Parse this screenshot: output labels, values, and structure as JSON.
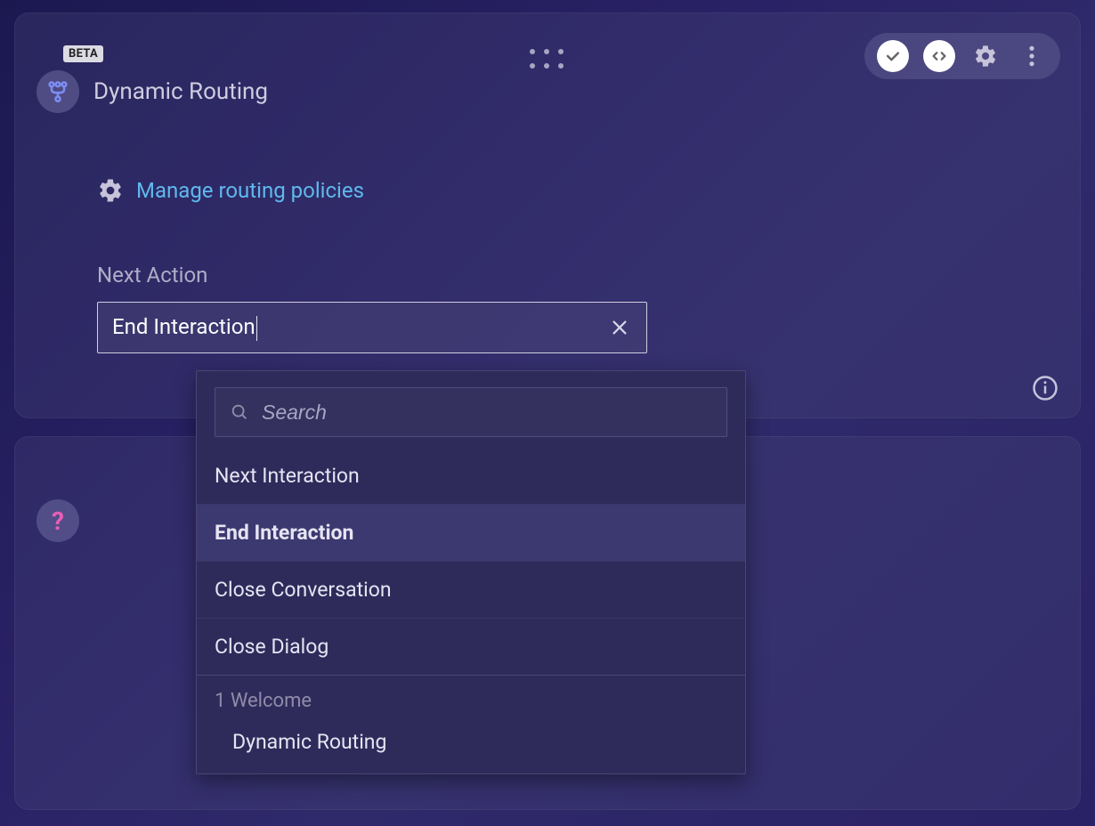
{
  "card": {
    "badge": "BETA",
    "title": "Dynamic Routing",
    "manage_link": "Manage routing policies",
    "field_label": "Next Action",
    "field_value": "End Interaction"
  },
  "dropdown": {
    "search_placeholder": "Search",
    "options": [
      {
        "label": "Next Interaction",
        "selected": false
      },
      {
        "label": "End Interaction",
        "selected": true
      },
      {
        "label": "Close Conversation",
        "selected": false
      },
      {
        "label": "Close Dialog",
        "selected": false
      }
    ],
    "groups": [
      {
        "label": "1 Welcome",
        "items": [
          "Dynamic Routing"
        ]
      }
    ]
  },
  "help": {
    "glyph": "?"
  }
}
